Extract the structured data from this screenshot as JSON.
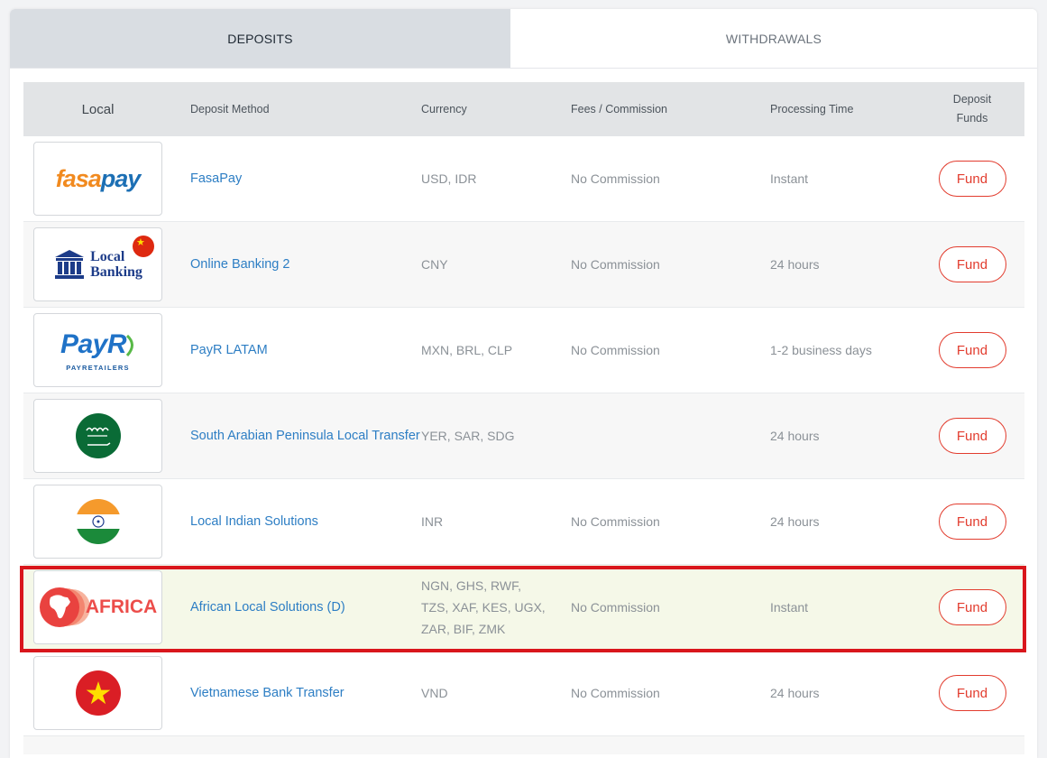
{
  "tabs": {
    "deposits": "DEPOSITS",
    "withdrawals": "WITHDRAWALS"
  },
  "table": {
    "headers": {
      "local": "Local",
      "method": "Deposit Method",
      "currency": "Currency",
      "fees": "Fees / Commission",
      "time": "Processing Time",
      "fund_line1": "Deposit",
      "fund_line2": "Funds"
    },
    "rows": [
      {
        "logo": "fasapay-logo",
        "method": "FasaPay",
        "currency": "USD, IDR",
        "fees": "No Commission",
        "time": "Instant",
        "button": "Fund"
      },
      {
        "logo": "local-banking-logo",
        "method": "Online Banking 2",
        "currency": "CNY",
        "fees": "No Commission",
        "time": "24 hours",
        "button": "Fund"
      },
      {
        "logo": "payr-logo",
        "method": "PayR LATAM",
        "currency": "MXN, BRL, CLP",
        "fees": "No Commission",
        "time": "1-2 business days",
        "button": "Fund"
      },
      {
        "logo": "saudi-flag-logo",
        "method": "South Arabian Peninsula Local Transfer",
        "currency": "YER, SAR, SDG",
        "fees": "",
        "time": "24 hours",
        "button": "Fund"
      },
      {
        "logo": "india-flag-logo",
        "method": "Local Indian Solutions",
        "currency": "INR",
        "fees": "No Commission",
        "time": "24 hours",
        "button": "Fund"
      },
      {
        "logo": "africa-logo",
        "method": "African Local Solutions (D)",
        "currency": "NGN, GHS, RWF, TZS, XAF, KES, UGX, ZAR, BIF, ZMK",
        "fees": "No Commission",
        "time": "Instant",
        "button": "Fund"
      },
      {
        "logo": "vietnam-flag-logo",
        "method": "Vietnamese Bank Transfer",
        "currency": "VND",
        "fees": "No Commission",
        "time": "24 hours",
        "button": "Fund"
      }
    ]
  },
  "logos": {
    "fasapay": {
      "part1": "fasa",
      "part2": "pay"
    },
    "local_banking": {
      "line1": "Local",
      "line2": "Banking"
    },
    "payr": {
      "main": "PayR",
      "sub": "PAYRETAILERS"
    },
    "africa": {
      "text": "AFRICA"
    }
  },
  "colors": {
    "accent_red": "#e23c2e",
    "link_blue": "#2d7ec4",
    "highlight_bg": "#f5f8e8",
    "annotation_red": "#d9161c"
  }
}
